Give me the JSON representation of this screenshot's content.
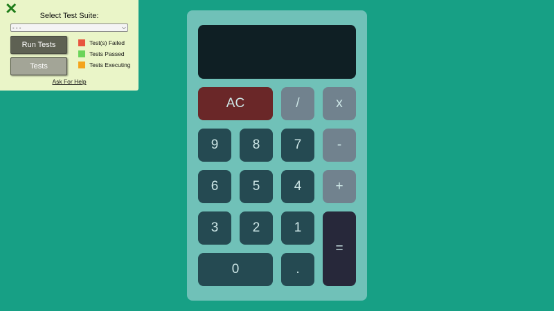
{
  "panel": {
    "close_icon": "✕",
    "title": "Select Test Suite:",
    "select_value": "- - -",
    "run_label": "Run Tests",
    "tests_label": "Tests",
    "legend": [
      {
        "label": "Test(s) Failed",
        "color": "#e8553f"
      },
      {
        "label": "Tests Passed",
        "color": "#6bd45a"
      },
      {
        "label": "Tests Executing",
        "color": "#f4a41c"
      }
    ],
    "help_label": "Ask For Help"
  },
  "calculator": {
    "display": "",
    "keys": {
      "clear": "AC",
      "divide": "/",
      "multiply": "x",
      "subtract": "-",
      "add": "+",
      "equals": "=",
      "decimal": ".",
      "d0": "0",
      "d1": "1",
      "d2": "2",
      "d3": "3",
      "d4": "4",
      "d5": "5",
      "d6": "6",
      "d7": "7",
      "d8": "8",
      "d9": "9"
    }
  }
}
